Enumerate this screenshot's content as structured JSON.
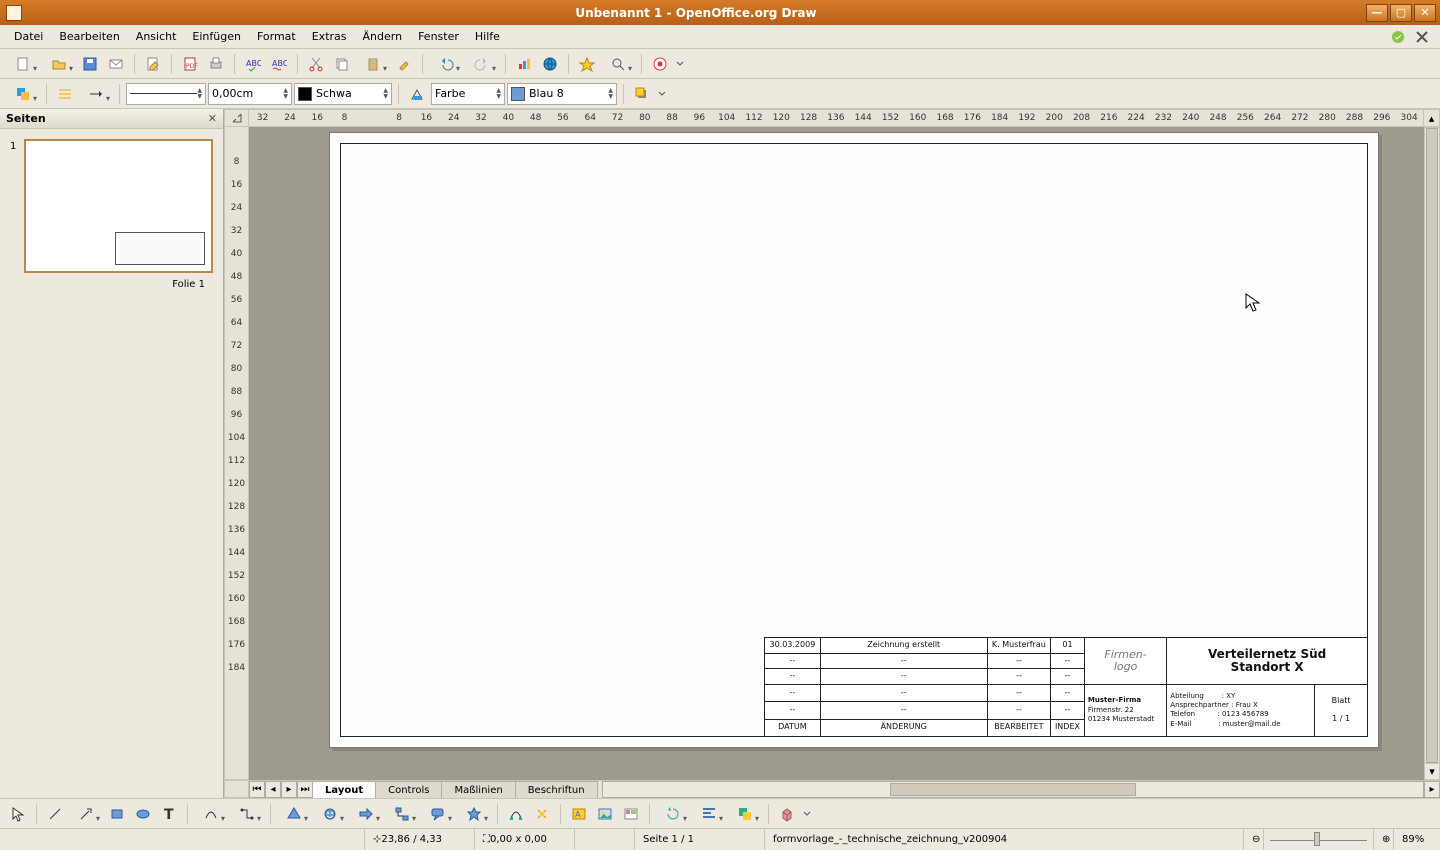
{
  "window": {
    "title": "Unbenannt 1 - OpenOffice.org Draw"
  },
  "menu": {
    "items": [
      "Datei",
      "Bearbeiten",
      "Ansicht",
      "Einfügen",
      "Format",
      "Extras",
      "Ändern",
      "Fenster",
      "Hilfe"
    ]
  },
  "toolbar2": {
    "line_width": "0,00cm",
    "line_color_label": "Schwa",
    "fill_mode": "Farbe",
    "fill_color_label": "Blau 8",
    "fill_color_hex": "#6e9bd6"
  },
  "sidepanel": {
    "title": "Seiten",
    "slide_num": "1",
    "caption": "Folie 1"
  },
  "ruler_h": [
    "32",
    "24",
    "16",
    "8",
    "",
    "8",
    "16",
    "24",
    "32",
    "40",
    "48",
    "56",
    "64",
    "72",
    "80",
    "88",
    "96",
    "104",
    "112",
    "120",
    "128",
    "136",
    "144",
    "152",
    "160",
    "168",
    "176",
    "184",
    "192",
    "200",
    "208",
    "216",
    "224",
    "232",
    "240",
    "248",
    "256",
    "264",
    "272",
    "280",
    "288",
    "296",
    "304"
  ],
  "ruler_v": [
    "",
    "8",
    "16",
    "24",
    "32",
    "40",
    "48",
    "56",
    "64",
    "72",
    "80",
    "88",
    "96",
    "104",
    "112",
    "120",
    "128",
    "136",
    "144",
    "152",
    "160",
    "168",
    "176",
    "184"
  ],
  "titleblock": {
    "rev_rows": [
      {
        "date": "30.03.2009",
        "change": "Zeichnung erstellt",
        "by": "K. Musterfrau",
        "idx": "01"
      },
      {
        "date": "--",
        "change": "--",
        "by": "--",
        "idx": "--"
      },
      {
        "date": "--",
        "change": "--",
        "by": "--",
        "idx": "--"
      },
      {
        "date": "--",
        "change": "--",
        "by": "--",
        "idx": "--"
      },
      {
        "date": "--",
        "change": "--",
        "by": "--",
        "idx": "--"
      }
    ],
    "rev_headers": {
      "date": "DATUM",
      "change": "ÄNDERUNG",
      "by": "BEARBEITET",
      "idx": "INDEX"
    },
    "logo": "Firmen-\nlogo",
    "drawing_title": "Verteilernetz Süd\nStandort X",
    "company": [
      "Muster-Firma",
      "Firmenstr. 22",
      "01234 Musterstadt"
    ],
    "contact": [
      {
        "k": "Abteilung",
        "v": "XY"
      },
      {
        "k": "Ansprechpartner",
        "v": "Frau X"
      },
      {
        "k": "Telefon",
        "v": "0123 456789"
      },
      {
        "k": "E-Mail",
        "v": "muster@mail.de"
      }
    ],
    "sheet_label": "Blatt",
    "sheet_value": "1 / 1"
  },
  "tabs": {
    "items": [
      "Layout",
      "Controls",
      "Maßlinien",
      "Beschriftun"
    ],
    "active": 0
  },
  "status": {
    "coords": "23,86 / 4,33",
    "size": "0,00 x 0,00",
    "page": "Seite 1 / 1",
    "template": "formvorlage_-_technische_zeichnung_v200904",
    "zoom": "89%"
  }
}
